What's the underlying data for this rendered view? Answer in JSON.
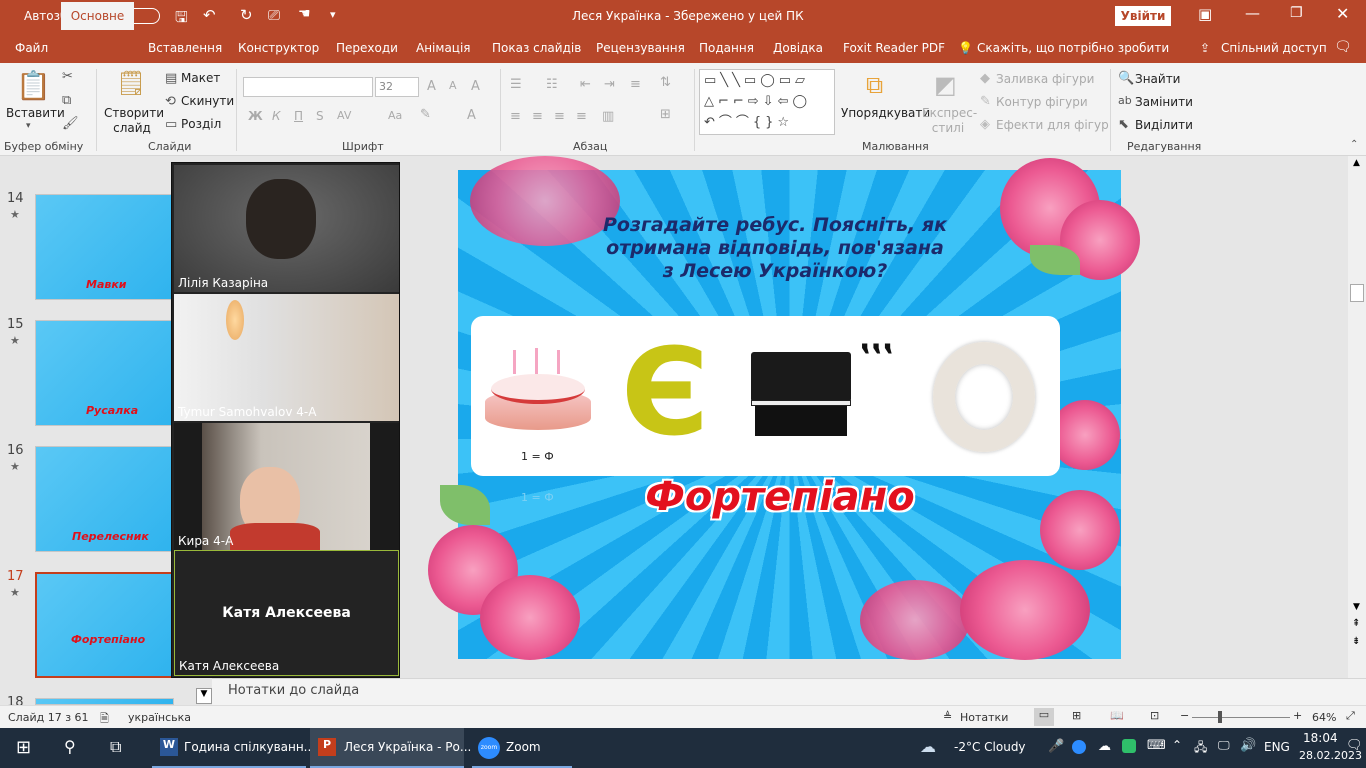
{
  "titlebar": {
    "autosave_label": "Автозбереження",
    "autosave_state": "Вимкнуто",
    "title": "Леся Українка  -  Збережено у цей ПК",
    "signin": "Увійти"
  },
  "tabs": [
    "Файл",
    "Основне",
    "Вставлення",
    "Конструктор",
    "Переходи",
    "Анімація",
    "Показ слайдів",
    "Рецензування",
    "Подання",
    "Довідка",
    "Foxit Reader PDF"
  ],
  "tell_me": "Скажіть, що потрібно зробити",
  "share": "Спільний доступ",
  "ribbon": {
    "paste": "Вставити",
    "clipboard_group": "Буфер обміну",
    "new_slide": "Створити слайд",
    "layout": "Макет",
    "reset": "Скинути",
    "section": "Розділ",
    "slides_group": "Слайди",
    "font_size": "32",
    "bold": "Ж",
    "italic": "К",
    "underline": "П",
    "strike": "S",
    "font_group": "Шрифт",
    "paragraph_group": "Абзац",
    "arrange": "Упорядкувати",
    "quick_styles": "Експрес-стилі",
    "shape_fill": "Заливка фігури",
    "shape_outline": "Контур фігури",
    "shape_effects": "Ефекти для фігур",
    "drawing_group": "Малювання",
    "find": "Знайти",
    "replace": "Замінити",
    "select": "Виділити",
    "editing_group": "Редагування"
  },
  "thumbnails": [
    {
      "num": "14",
      "label": "Мавки"
    },
    {
      "num": "15",
      "label": "Русалка"
    },
    {
      "num": "16",
      "label": "Перелесник"
    },
    {
      "num": "17",
      "label": "Фортепіано"
    },
    {
      "num": "18",
      "label": ""
    }
  ],
  "participants": [
    {
      "name": "Лілія Казаріна"
    },
    {
      "name": "Tymur Samohvalov 4-А"
    },
    {
      "name": "Кира 4-А"
    },
    {
      "name": "Катя Алексеева",
      "display": "Катя Алексеева"
    }
  ],
  "slide": {
    "question": "Розгадайте ребус. Поясніть, як отримана відповідь, пов'язана з Лесею Українкою?",
    "cake_note": "1 = Ф",
    "ghost_note": "1 = Ф",
    "letter": "Є",
    "commas": ",,,",
    "answer": "Фортепіано"
  },
  "notes_placeholder": "Нотатки до слайда",
  "status": {
    "slide": "Слайд 17 з 61",
    "language": "українська",
    "notes_btn": "Нотатки",
    "zoom": "64%"
  },
  "taskbar": {
    "apps": [
      "Година спілкуванн...",
      "Леся Українка - Ро...",
      "Zoom"
    ],
    "weather": "-2°C  Cloudy",
    "lang": "ENG",
    "time": "18:04",
    "date": "28.02.2023"
  },
  "colors": {
    "accent": "#b7472a",
    "answer": "#e3101e",
    "question": "#1c2a6b"
  }
}
